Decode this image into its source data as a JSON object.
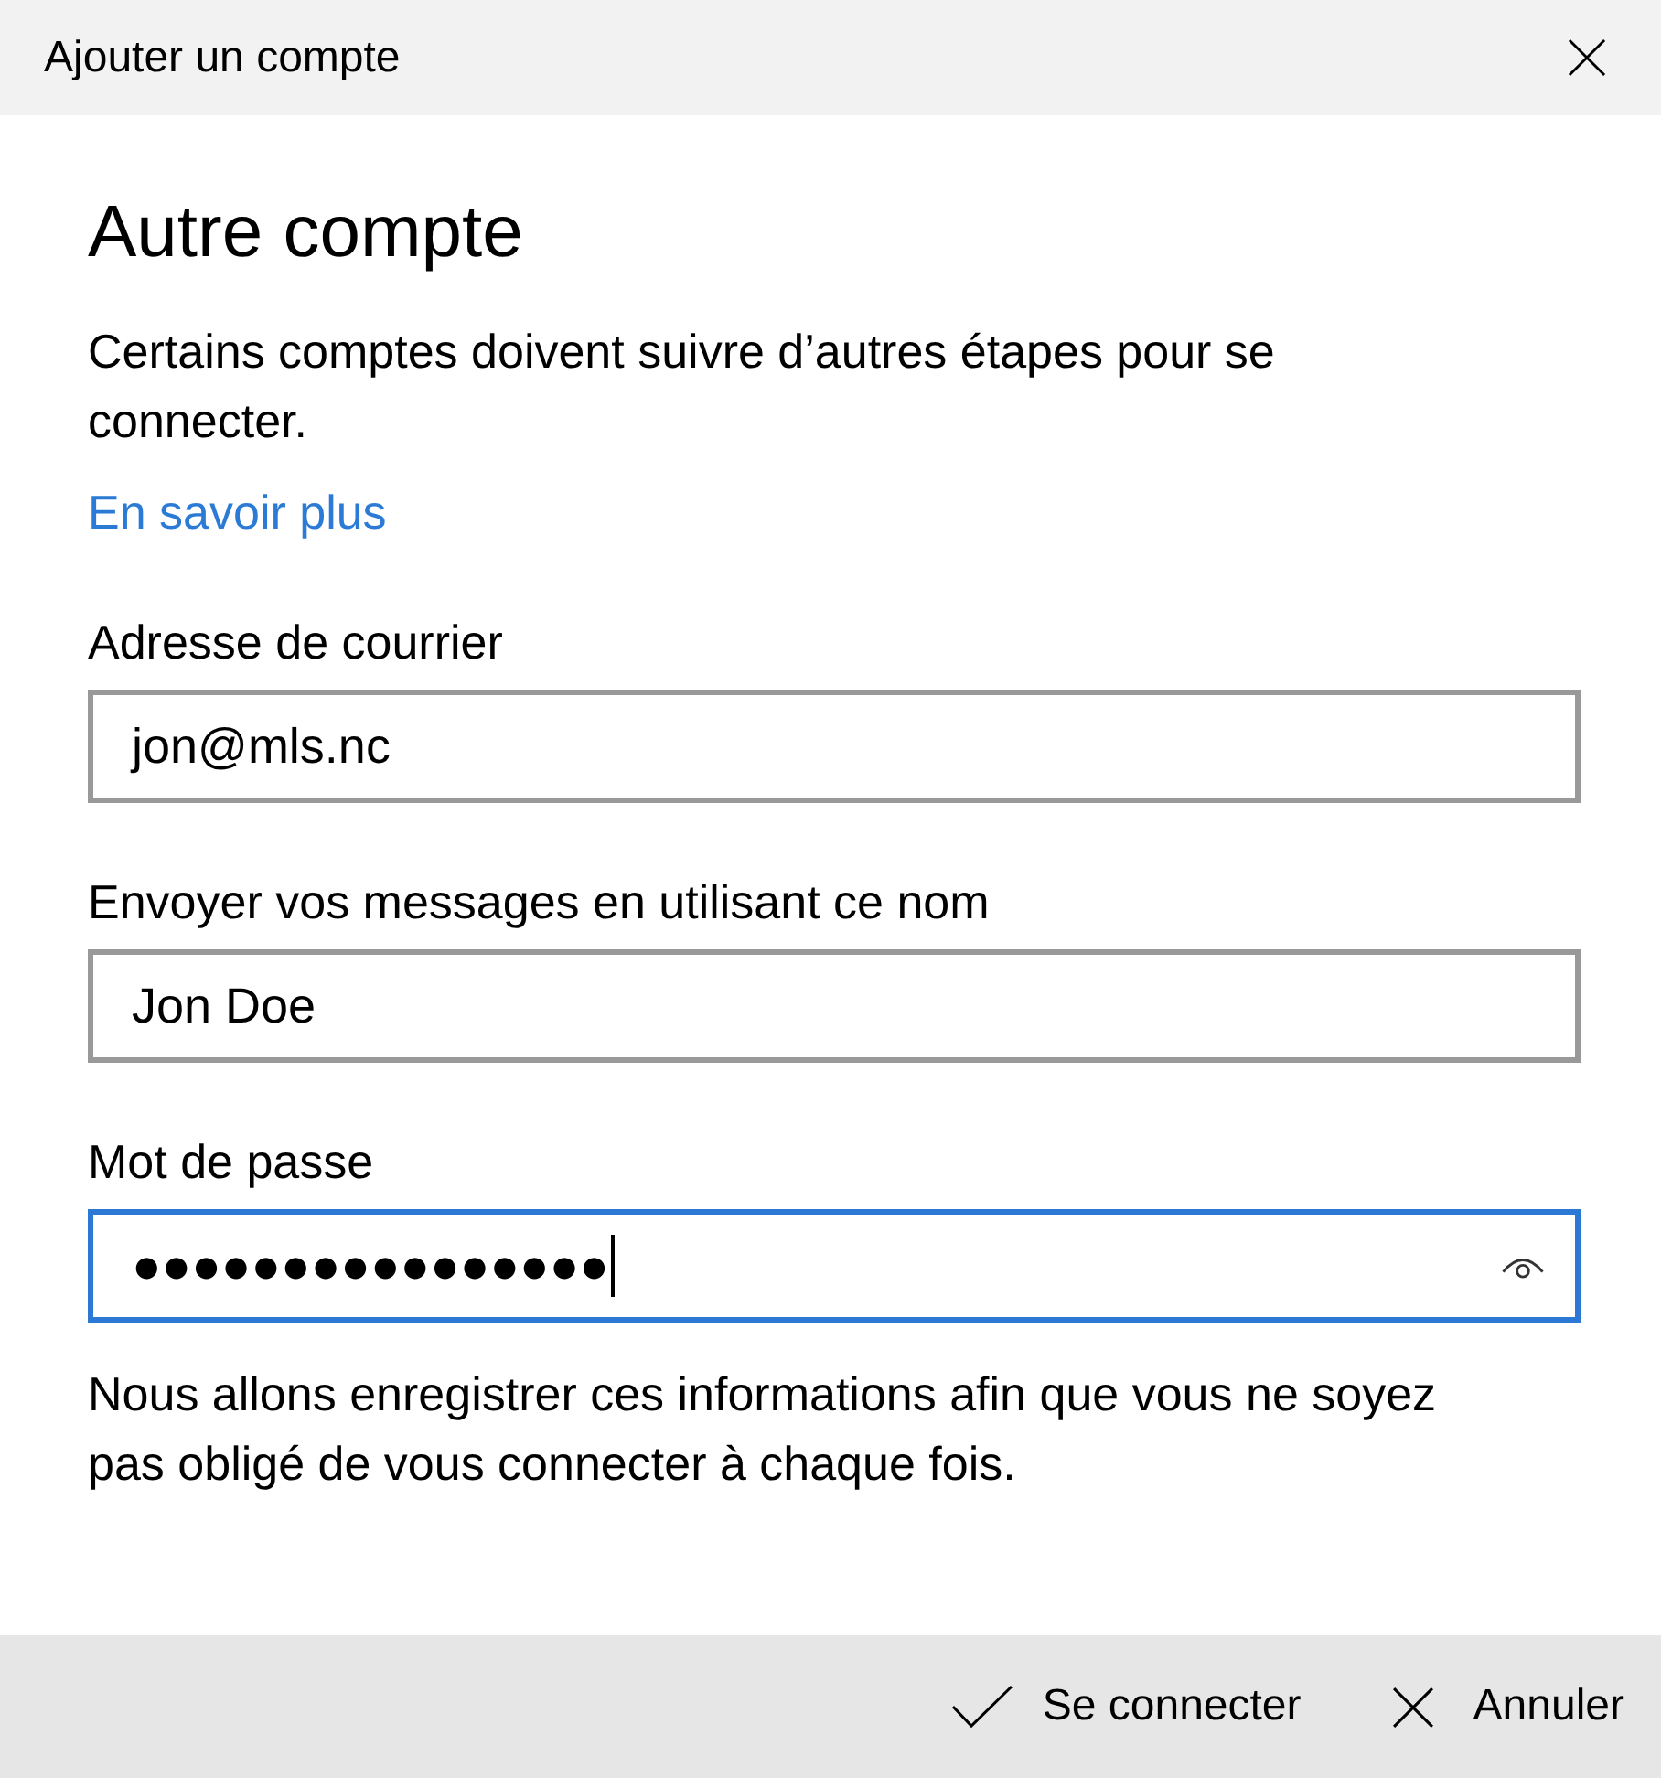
{
  "window": {
    "title": "Ajouter un compte"
  },
  "heading": "Autre compte",
  "description": "Certains comptes doivent suivre d’autres étapes pour se connecter.",
  "learn_more_link": "En savoir plus",
  "fields": [
    {
      "kind": "text",
      "label": "Adresse de courrier",
      "value": "jon@mls.nc",
      "focused": false
    },
    {
      "kind": "text",
      "label": "Envoyer vos messages en utilisant ce nom",
      "value": "Jon Doe",
      "focused": false
    },
    {
      "kind": "password",
      "label": "Mot de passe",
      "value": "●●●●●●●●●●●●●●●●",
      "focused": true
    }
  ],
  "note": "Nous allons enregistrer ces informations afin que vous ne soyez pas obligé de vous connecter à chaque fois.",
  "buttons": [
    {
      "kind": "confirm",
      "label": "Se connecter"
    },
    {
      "kind": "cancel",
      "label": "Annuler"
    }
  ]
}
